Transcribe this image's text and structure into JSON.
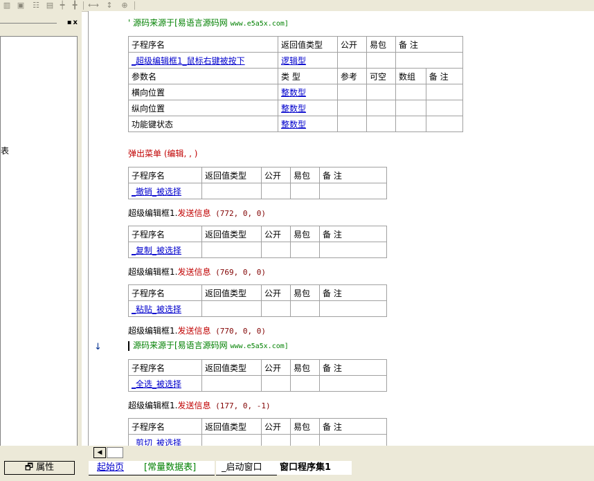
{
  "toolbar": {
    "icons": [
      "grid-split-icon",
      "grid-merge-icon",
      "grid-rows-icon",
      "grid-cols-icon",
      "align-width-icon",
      "align-height-icon",
      "same-width-icon",
      "same-height-icon",
      "center-both-icon"
    ]
  },
  "left_panel": {
    "title_buttons": "▪x",
    "truncated_text": "表"
  },
  "editor": {
    "comment1": "' 源码来源于[易语言源码网 ",
    "comment1_url": "www.e5a5x.com]",
    "comment2": "源码来源于[易语言源码网 ",
    "comment2_url": "www.e5a5x.com]",
    "main_sub": {
      "headers": [
        "子程序名",
        "返回值类型",
        "公开",
        "易包",
        "备 注"
      ],
      "name": "_超级编辑框1_鼠标右键被按下",
      "return_type": "逻辑型",
      "param_headers": [
        "参数名",
        "类 型",
        "参考",
        "可空",
        "数组",
        "备 注"
      ],
      "params": [
        {
          "name": "横向位置",
          "type": "整数型"
        },
        {
          "name": "纵向位置",
          "type": "整数型"
        },
        {
          "name": "功能键状态",
          "type": "整数型"
        }
      ]
    },
    "popup_line": "弹出菜单 (编辑, , )",
    "sub_headers": [
      "子程序名",
      "返回值类型",
      "公开",
      "易包",
      "备 注"
    ],
    "subs": [
      {
        "name": "_撤销_被选择",
        "call_obj": "超级编辑框1.",
        "call_fn": "发送信息",
        "call_args": " (772, 0, 0)"
      },
      {
        "name": "_复制_被选择",
        "call_obj": "超级编辑框1.",
        "call_fn": "发送信息",
        "call_args": " (769, 0, 0)"
      },
      {
        "name": "_粘贴_被选择",
        "call_obj": "超级编辑框1.",
        "call_fn": "发送信息",
        "call_args": " (770, 0, 0)"
      },
      {
        "name": "_全选_被选择",
        "call_obj": "超级编辑框1.",
        "call_fn": "发送信息",
        "call_args": " (177, 0, -1)"
      },
      {
        "name": "_剪切_被选择",
        "call_obj": "",
        "call_fn": "",
        "call_args": ""
      }
    ],
    "gutter_arrow": "↓"
  },
  "bottom": {
    "properties_label": "属性",
    "tabs": [
      "起始页",
      "[常量数据表]",
      "_启动窗口",
      "窗口程序集1"
    ],
    "active_tab": "窗口程序集1"
  },
  "colors": {
    "comment": "#008000",
    "link": "#0000cc",
    "keyword": "#c00000",
    "chrome": "#ece9d8"
  }
}
